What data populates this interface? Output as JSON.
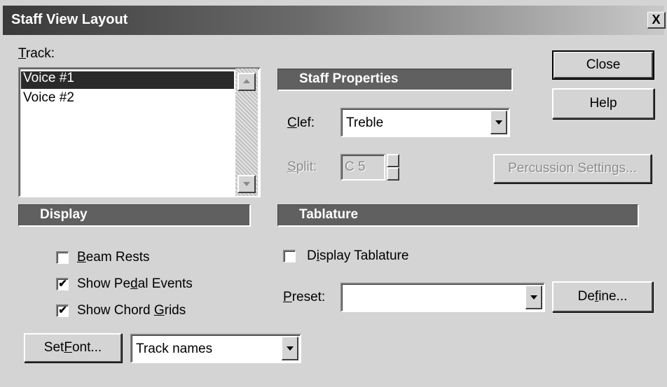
{
  "window": {
    "title": "Staff View Layout",
    "close_glyph": "X"
  },
  "track": {
    "label": "Track:",
    "items": [
      "Voice #1",
      "Voice #2"
    ],
    "selected_index": 0
  },
  "buttons": {
    "close": "Close",
    "help": "Help",
    "percussion": "Percussion Settings...",
    "define": "Define...",
    "set_font": "Set Font..."
  },
  "staff_properties": {
    "header": "Staff Properties",
    "clef_label": "Clef:",
    "clef_value": "Treble",
    "split_label": "Split:",
    "split_value": "C 5"
  },
  "display": {
    "header": "Display",
    "options": [
      {
        "label": "Beam Rests",
        "checked": false
      },
      {
        "label": "Show Pedal Events",
        "checked": true
      },
      {
        "label": "Show Chord Grids",
        "checked": true
      }
    ]
  },
  "tablature": {
    "header": "Tablature",
    "display_label": "Display Tablature",
    "display_checked": false,
    "preset_label": "Preset:",
    "preset_value": ""
  },
  "font_target": {
    "value": "Track names"
  },
  "icons": {
    "dropdown_arrow": "chevron-down-icon",
    "scroll_up": "scroll-up-arrow-icon",
    "scroll_down": "scroll-down-arrow-icon",
    "check": "checkmark-icon"
  },
  "colors": {
    "titlebar_dark": "#3a3a3a",
    "face": "#d4d4d4",
    "section_header": "#606060",
    "selection": "#2a2a2a"
  }
}
